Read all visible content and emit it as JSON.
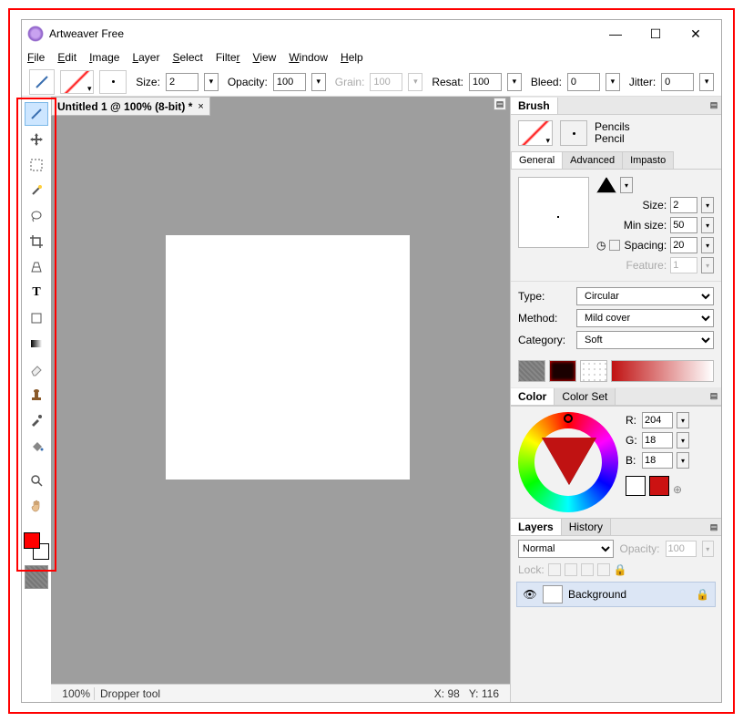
{
  "app": {
    "title": "Artweaver Free"
  },
  "menu": {
    "file": "File",
    "edit": "Edit",
    "image": "Image",
    "layer": "Layer",
    "select": "Select",
    "filter": "Filter",
    "view": "View",
    "window": "Window",
    "help": "Help"
  },
  "options": {
    "size_label": "Size:",
    "size_val": "2",
    "opacity_label": "Opacity:",
    "opacity_val": "100",
    "grain_label": "Grain:",
    "grain_val": "100",
    "resat_label": "Resat:",
    "resat_val": "100",
    "bleed_label": "Bleed:",
    "bleed_val": "0",
    "jitter_label": "Jitter:",
    "jitter_val": "0"
  },
  "document": {
    "tab_title": "Untitled 1 @ 100% (8-bit) *"
  },
  "status": {
    "zoom": "100%",
    "tool": "Dropper tool",
    "x_label": "X:",
    "x": "98",
    "y_label": "Y:",
    "y": "116"
  },
  "brush": {
    "panel": "Brush",
    "family": "Pencils",
    "variant": "Pencil",
    "tabs": {
      "general": "General",
      "advanced": "Advanced",
      "impasto": "Impasto"
    },
    "params": {
      "size_label": "Size:",
      "size": "2",
      "minsize_label": "Min size:",
      "minsize": "50",
      "spacing_label": "Spacing:",
      "spacing": "20",
      "feature_label": "Feature:",
      "feature": "1"
    },
    "type_label": "Type:",
    "type": "Circular",
    "method_label": "Method:",
    "method": "Mild cover",
    "category_label": "Category:",
    "category": "Soft"
  },
  "color": {
    "panel": "Color",
    "colorset": "Color Set",
    "r_label": "R:",
    "r": "204",
    "g_label": "G:",
    "g": "18",
    "b_label": "B:",
    "b": "18",
    "fg": "#cc1212",
    "bg": "#ffffff"
  },
  "layers": {
    "panel": "Layers",
    "history": "History",
    "blend": "Normal",
    "opacity_label": "Opacity:",
    "opacity": "100",
    "lock_label": "Lock:",
    "items": [
      {
        "name": "Background"
      }
    ]
  },
  "tools": {
    "brush": "brush-tool",
    "move": "move-tool",
    "marquee": "marquee-tool",
    "wand": "magic-wand-tool",
    "lasso": "lasso-tool",
    "crop": "crop-tool",
    "perspective": "perspective-tool",
    "text": "text-tool",
    "shape": "shape-tool",
    "gradient": "gradient-tool",
    "eraser": "eraser-tool",
    "stamp": "stamp-tool",
    "dropper": "eyedropper-tool",
    "fill": "paint-bucket-tool",
    "zoom": "zoom-tool",
    "hand": "hand-tool"
  }
}
